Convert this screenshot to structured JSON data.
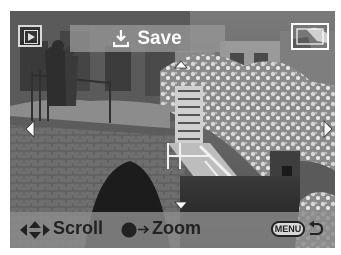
{
  "toolbar": {
    "save_label": "Save"
  },
  "footer": {
    "scroll_label": "Scroll",
    "zoom_label": "Zoom",
    "menu_label": "MENU"
  },
  "icons": {
    "play": "playback-mode-icon",
    "save": "save-icon",
    "thumbnail": "navigation-thumbnail",
    "arrows": "four-way-scroll-arrows",
    "center_button": "center-button-icon",
    "back": "return-arrow-icon"
  },
  "colors": {
    "overlay": "#969696",
    "text_light": "#ffffff",
    "text_dark": "#222222"
  }
}
